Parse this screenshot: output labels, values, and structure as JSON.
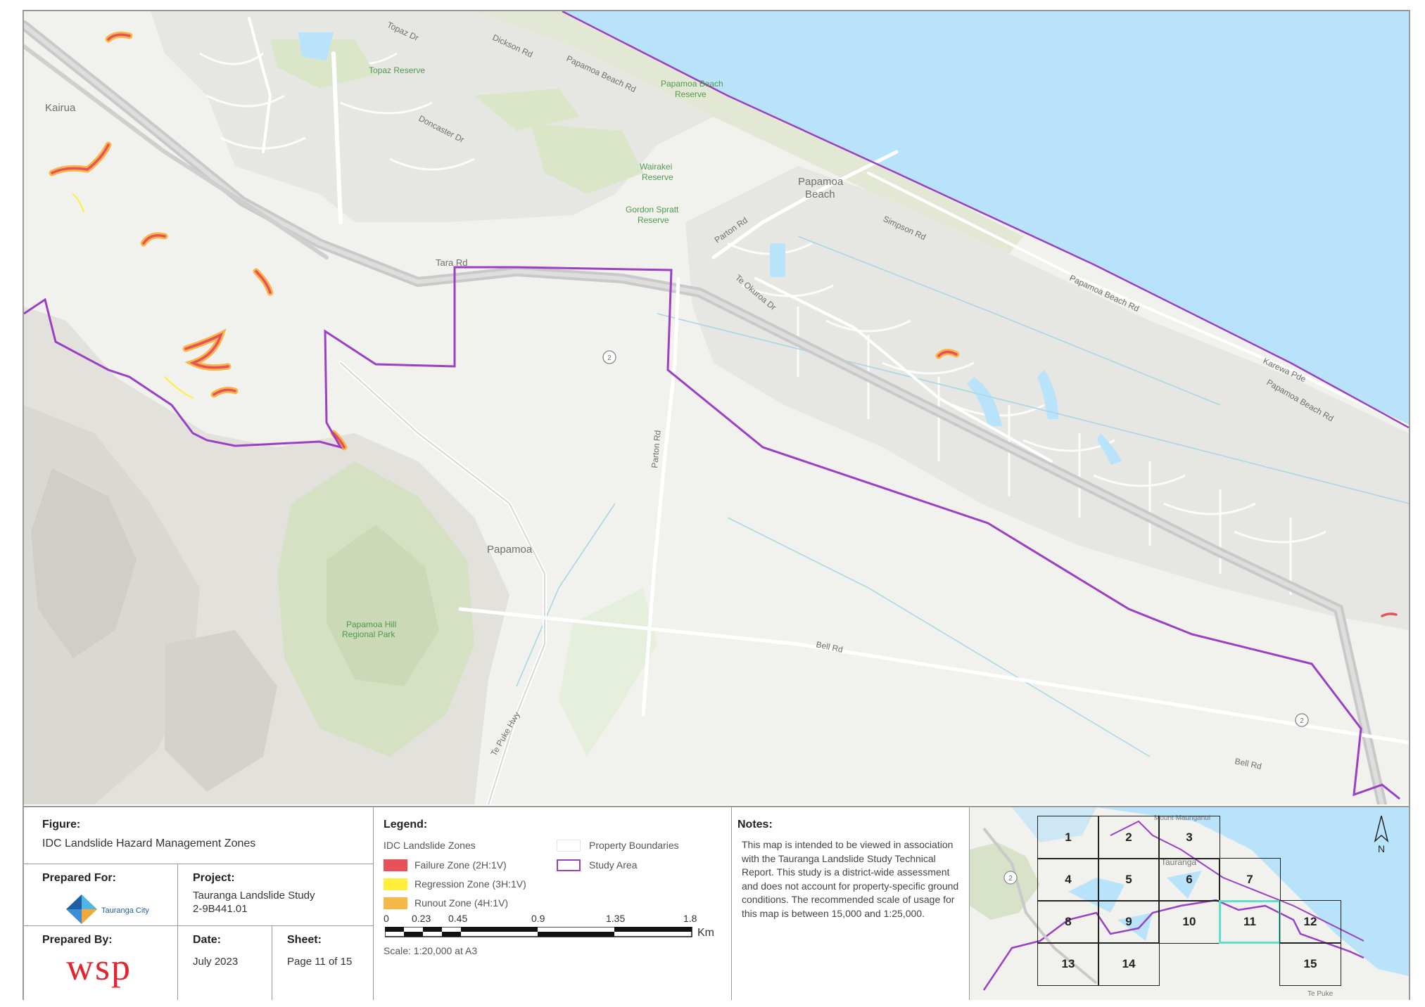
{
  "map": {
    "place_labels": {
      "kairua": "Kairua",
      "papamoa_beach": [
        "Papamoa",
        "Beach"
      ],
      "papamoa": "Papamoa"
    },
    "road_labels": {
      "topaz_dr": "Topaz Dr",
      "dickson_rd": "Dickson Rd",
      "papamoa_beach_rd_1": "Papamoa Beach Rd",
      "doncaster_dr": "Doncaster Dr",
      "parton_rd_1": "Parton Rd",
      "simpson_rd": "Simpson Rd",
      "te_okuroa_dr": "Te Okuroa Dr",
      "papamoa_beach_rd_2": "Papamoa Beach Rd",
      "karewa_pde": "Karewa Pde",
      "papamoa_beach_rd_3": "Papamoa Beach Rd",
      "tara_rd": "Tara Rd",
      "parton_rd_2": "Parton Rd",
      "bell_rd_1": "Bell Rd",
      "bell_rd_2": "Bell Rd",
      "te_puke_hwy": "Te Puke Hwy",
      "sh2_a": "2",
      "sh2_b": "2"
    },
    "reserve_labels": {
      "topaz_reserve": "Topaz Reserve",
      "papamoa_beach_reserve": [
        "Papamoa Beach",
        "Reserve"
      ],
      "wairakei_reserve": [
        "Wairakei",
        "Reserve"
      ],
      "gordon_spratt_reserve": [
        "Gordon Spratt",
        "Reserve"
      ],
      "papamoa_hills": [
        "Papamoa Hill",
        "Regional Park"
      ]
    },
    "colors": {
      "sea": "#b8e3fa",
      "land": "#f1f1ee",
      "study_area": "#9b3fc4",
      "failure": "#e8505a",
      "regression": "#ffef3a",
      "runout": "#f7b84a",
      "highway": "#c6c6c6",
      "park": "#dfe8cf"
    }
  },
  "panel": {
    "figure_label": "Figure:",
    "figure_title": "IDC Landslide Hazard Management Zones",
    "prepared_for_label": "Prepared For:",
    "client_logo_text": "Tauranga City",
    "project_label": "Project:",
    "project_name": "Tauranga Landslide Study",
    "project_number": "2-9B441.01",
    "prepared_by_label": "Prepared By:",
    "consultant_logo": "wsp",
    "date_label": "Date:",
    "date_value": "July 2023",
    "sheet_label": "Sheet:",
    "sheet_value": "Page 11 of 15",
    "legend_label": "Legend:",
    "legend_group": "IDC Landslide Zones",
    "legend_items": {
      "failure": "Failure Zone (2H:1V)",
      "regression": "Regression Zone (3H:1V)",
      "runout": "Runout Zone (4H:1V)",
      "property": "Property Boundaries",
      "study_area": "Study Area"
    },
    "scale_ticks": [
      "0",
      "0.23",
      "0.45",
      "0.9",
      "1.35",
      "1.8"
    ],
    "scale_unit": "Km",
    "scale_text": "Scale: 1:20,000 at A3",
    "notes_label": "Notes:",
    "notes_text": "This map is intended to be viewed in association with the Tauranga Landslide Study Technical Report. This study is a district-wide assessment and does not account for property-specific ground conditions. The recommended scale of usage for this map is between 15,000 and 1:25,000.",
    "inset": {
      "sheets": [
        "1",
        "2",
        "3",
        "4",
        "5",
        "6",
        "7",
        "8",
        "9",
        "10",
        "11",
        "12",
        "13",
        "14",
        "15"
      ],
      "current_sheet": "11",
      "north": "N",
      "place_1": "Mount Maunganui",
      "place_2": "Tauranga",
      "place_3": "Te Puke",
      "shield": "2"
    }
  }
}
